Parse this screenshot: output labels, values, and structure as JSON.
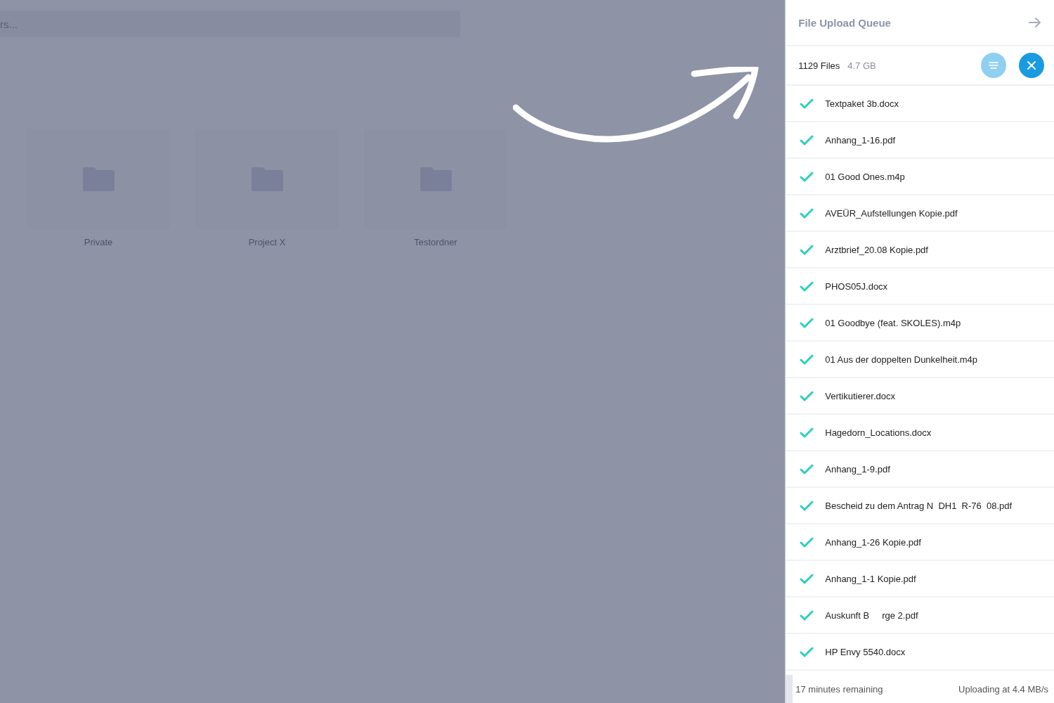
{
  "search": {
    "placeholder": "rs..."
  },
  "folders": [
    {
      "name": "Private"
    },
    {
      "name": "Project X"
    },
    {
      "name": "Testordner"
    }
  ],
  "panel": {
    "title": "File Upload Queue",
    "count": "1129 Files",
    "size": "4.7 GB",
    "files": [
      {
        "name": "Textpaket 3b.docx",
        "done": true
      },
      {
        "name": "Anhang_1-16.pdf",
        "done": true
      },
      {
        "name": "01 Good Ones.m4p",
        "done": true
      },
      {
        "name": "AVEÜR_Aufstellungen Kopie.pdf",
        "done": true
      },
      {
        "name": "Arztbrief_20.08 Kopie.pdf",
        "done": true
      },
      {
        "name": "PHOS05J.docx",
        "done": true
      },
      {
        "name": "01 Goodbye (feat. SKOLES).m4p",
        "done": true
      },
      {
        "name": "01 Aus der doppelten Dunkelheit.m4p",
        "done": true
      },
      {
        "name": "Vertikutierer.docx",
        "done": true
      },
      {
        "name": "Hagedorn_Locations.docx",
        "done": true
      },
      {
        "name": "Anhang_1-9.pdf",
        "done": true
      },
      {
        "name": "Bescheid zu dem Antrag N  DH1  R-76  08.pdf",
        "done": true
      },
      {
        "name": "Anhang_1-26 Kopie.pdf",
        "done": true
      },
      {
        "name": "Anhang_1-1 Kopie.pdf",
        "done": true
      },
      {
        "name": "Auskunft B     rge 2.pdf",
        "done": true
      },
      {
        "name": "HP Envy 5540.docx",
        "done": true
      }
    ],
    "remaining": "17 minutes remaining",
    "speed": "Uploading at 4.4 MB/s"
  }
}
